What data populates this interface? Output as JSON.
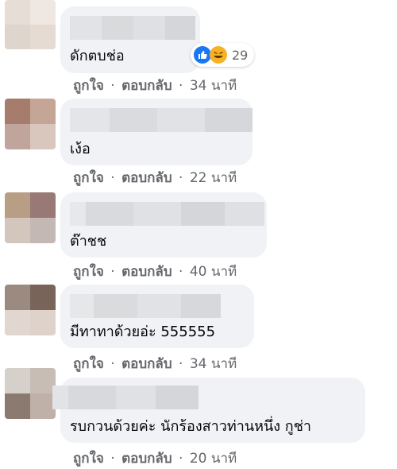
{
  "actions": {
    "like": "ถูกใจ",
    "reply": "ตอบกลับ",
    "separator": "·"
  },
  "comments": [
    {
      "text": "ดักตบช่อ",
      "time": "34 นาที",
      "reactions": {
        "count": "29",
        "icons": [
          "like-icon",
          "haha-icon"
        ]
      }
    },
    {
      "text": "เง้อ",
      "time": "22 นาที"
    },
    {
      "text": "ต๊าชช",
      "time": "40 นาที"
    },
    {
      "text": "มีทาทาด้วยอ่ะ 555555",
      "time": "34 นาที"
    },
    {
      "text": "รบกวนด้วยค่ะ นักร้องสาวท่านหนึ่ง กูช่า",
      "time": "20 นาที"
    }
  ],
  "colors": {
    "bubble": "#f0f2f5",
    "meta_text": "#65676b",
    "like_blue": "#1877f2",
    "haha_yellow": "#f7b125"
  }
}
